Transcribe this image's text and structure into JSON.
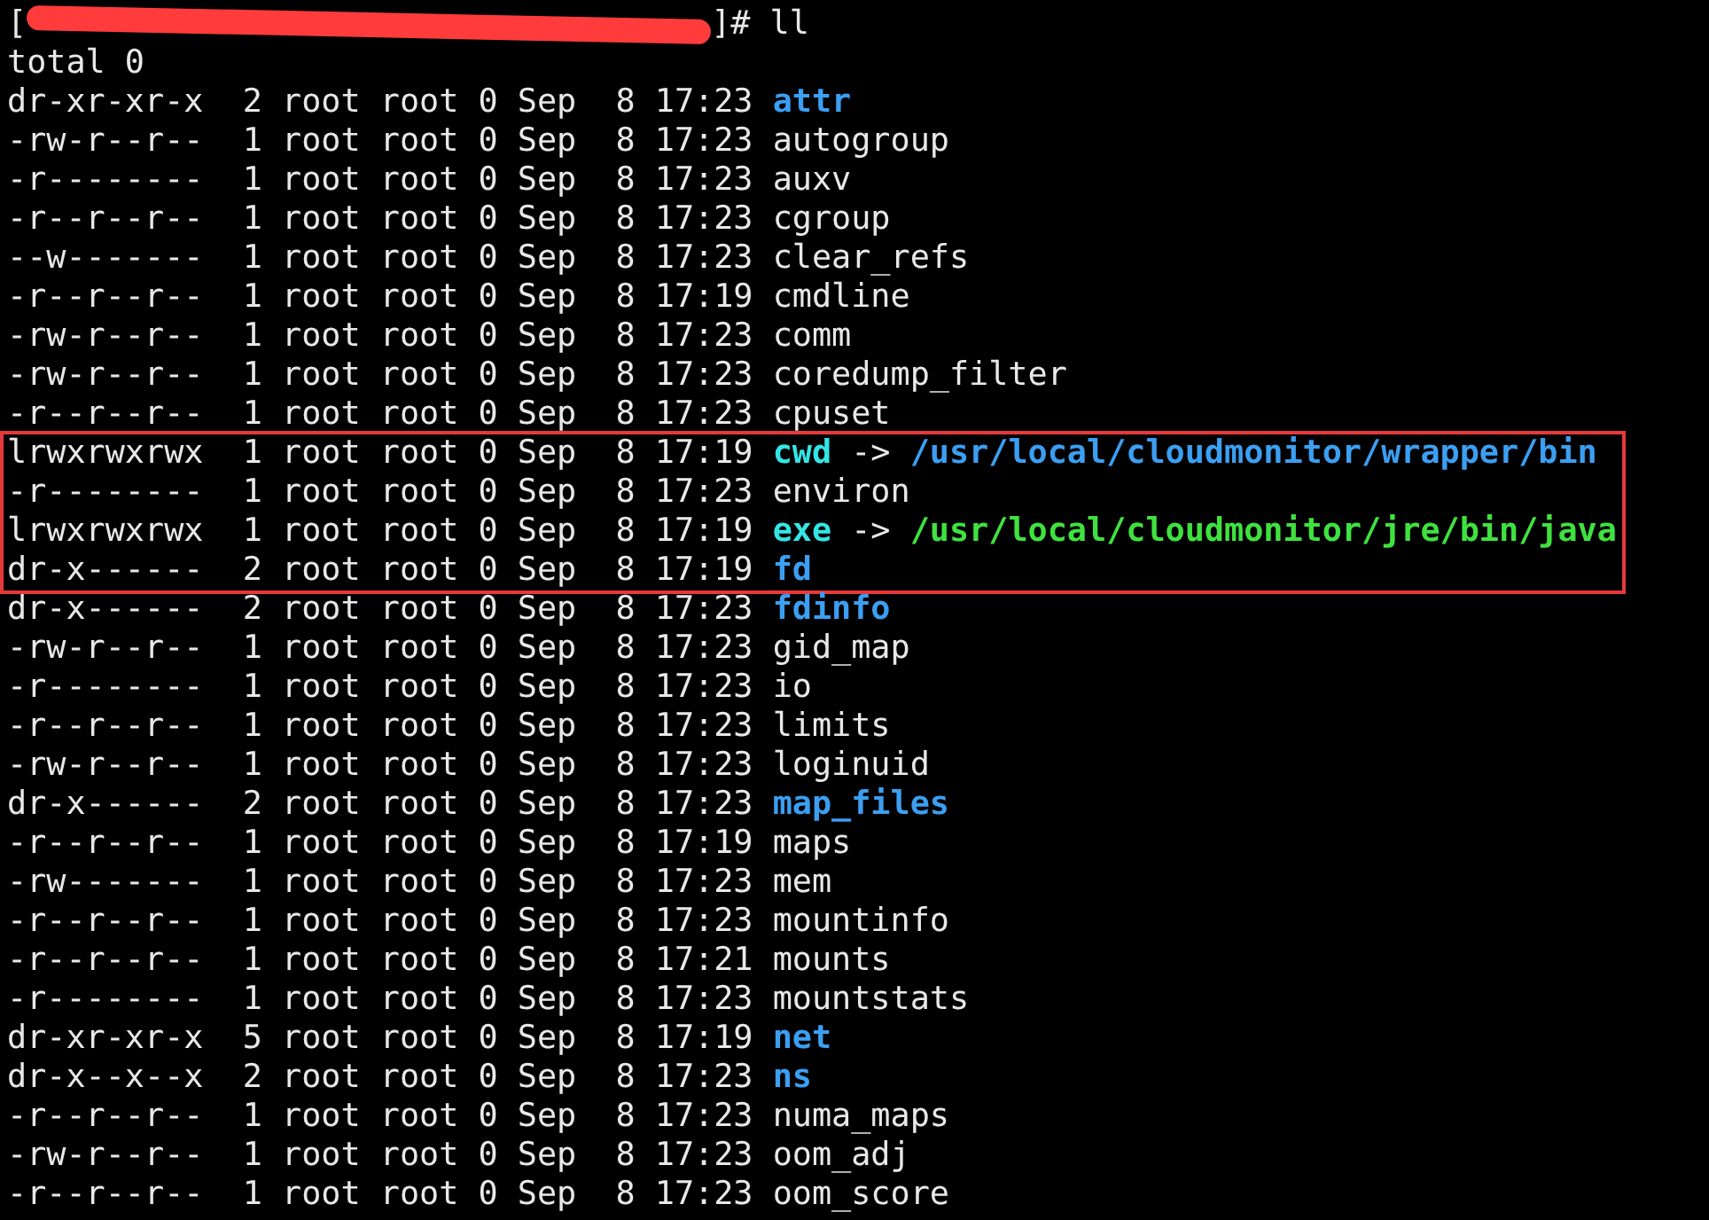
{
  "prompt": {
    "start": "[",
    "end": "]# ll",
    "redacted": true
  },
  "summary": "total 0",
  "entries": [
    {
      "listing": "dr-xr-xr-x  2 root root 0 Sep  8 17:23",
      "name": "attr",
      "kind": "dir",
      "highlighted": false
    },
    {
      "listing": "-rw-r--r--  1 root root 0 Sep  8 17:23",
      "name": "autogroup",
      "kind": "file",
      "highlighted": false
    },
    {
      "listing": "-r--------  1 root root 0 Sep  8 17:23",
      "name": "auxv",
      "kind": "file",
      "highlighted": false
    },
    {
      "listing": "-r--r--r--  1 root root 0 Sep  8 17:23",
      "name": "cgroup",
      "kind": "file",
      "highlighted": false
    },
    {
      "listing": "--w-------  1 root root 0 Sep  8 17:23",
      "name": "clear_refs",
      "kind": "file",
      "highlighted": false
    },
    {
      "listing": "-r--r--r--  1 root root 0 Sep  8 17:19",
      "name": "cmdline",
      "kind": "file",
      "highlighted": false
    },
    {
      "listing": "-rw-r--r--  1 root root 0 Sep  8 17:23",
      "name": "comm",
      "kind": "file",
      "highlighted": false
    },
    {
      "listing": "-rw-r--r--  1 root root 0 Sep  8 17:23",
      "name": "coredump_filter",
      "kind": "file",
      "highlighted": false
    },
    {
      "listing": "-r--r--r--  1 root root 0 Sep  8 17:23",
      "name": "cpuset",
      "kind": "file",
      "highlighted": false
    },
    {
      "listing": "lrwxrwxrwx  1 root root 0 Sep  8 17:19",
      "name": "cwd",
      "kind": "link",
      "arrow": "->",
      "target": {
        "text": "/usr/local/cloudmonitor/wrapper/bin",
        "kind": "dir"
      },
      "highlighted": true
    },
    {
      "listing": "-r--------  1 root root 0 Sep  8 17:23",
      "name": "environ",
      "kind": "file",
      "highlighted": true
    },
    {
      "listing": "lrwxrwxrwx  1 root root 0 Sep  8 17:19",
      "name": "exe",
      "kind": "link",
      "arrow": "->",
      "target": {
        "text": "/usr/local/cloudmonitor/jre/bin/java",
        "kind": "exec"
      },
      "highlighted": true
    },
    {
      "listing": "dr-x------  2 root root 0 Sep  8 17:19",
      "name": "fd",
      "kind": "dir",
      "highlighted": true
    },
    {
      "listing": "dr-x------  2 root root 0 Sep  8 17:23",
      "name": "fdinfo",
      "kind": "dir",
      "highlighted": false
    },
    {
      "listing": "-rw-r--r--  1 root root 0 Sep  8 17:23",
      "name": "gid_map",
      "kind": "file",
      "highlighted": false
    },
    {
      "listing": "-r--------  1 root root 0 Sep  8 17:23",
      "name": "io",
      "kind": "file",
      "highlighted": false
    },
    {
      "listing": "-r--r--r--  1 root root 0 Sep  8 17:23",
      "name": "limits",
      "kind": "file",
      "highlighted": false
    },
    {
      "listing": "-rw-r--r--  1 root root 0 Sep  8 17:23",
      "name": "loginuid",
      "kind": "file",
      "highlighted": false
    },
    {
      "listing": "dr-x------  2 root root 0 Sep  8 17:23",
      "name": "map_files",
      "kind": "dir",
      "highlighted": false
    },
    {
      "listing": "-r--r--r--  1 root root 0 Sep  8 17:19",
      "name": "maps",
      "kind": "file",
      "highlighted": false
    },
    {
      "listing": "-rw-------  1 root root 0 Sep  8 17:23",
      "name": "mem",
      "kind": "file",
      "highlighted": false
    },
    {
      "listing": "-r--r--r--  1 root root 0 Sep  8 17:23",
      "name": "mountinfo",
      "kind": "file",
      "highlighted": false
    },
    {
      "listing": "-r--r--r--  1 root root 0 Sep  8 17:21",
      "name": "mounts",
      "kind": "file",
      "highlighted": false
    },
    {
      "listing": "-r--------  1 root root 0 Sep  8 17:23",
      "name": "mountstats",
      "kind": "file",
      "highlighted": false
    },
    {
      "listing": "dr-xr-xr-x  5 root root 0 Sep  8 17:19",
      "name": "net",
      "kind": "dir",
      "highlighted": false
    },
    {
      "listing": "dr-x--x--x  2 root root 0 Sep  8 17:23",
      "name": "ns",
      "kind": "dir",
      "highlighted": false
    },
    {
      "listing": "-r--r--r--  1 root root 0 Sep  8 17:23",
      "name": "numa_maps",
      "kind": "file",
      "highlighted": false
    },
    {
      "listing": "-rw-r--r--  1 root root 0 Sep  8 17:23",
      "name": "oom_adj",
      "kind": "file",
      "highlighted": false
    },
    {
      "listing": "-r--r--r--  1 root root 0 Sep  8 17:23",
      "name": "oom_score",
      "kind": "file",
      "highlighted": false
    }
  ]
}
